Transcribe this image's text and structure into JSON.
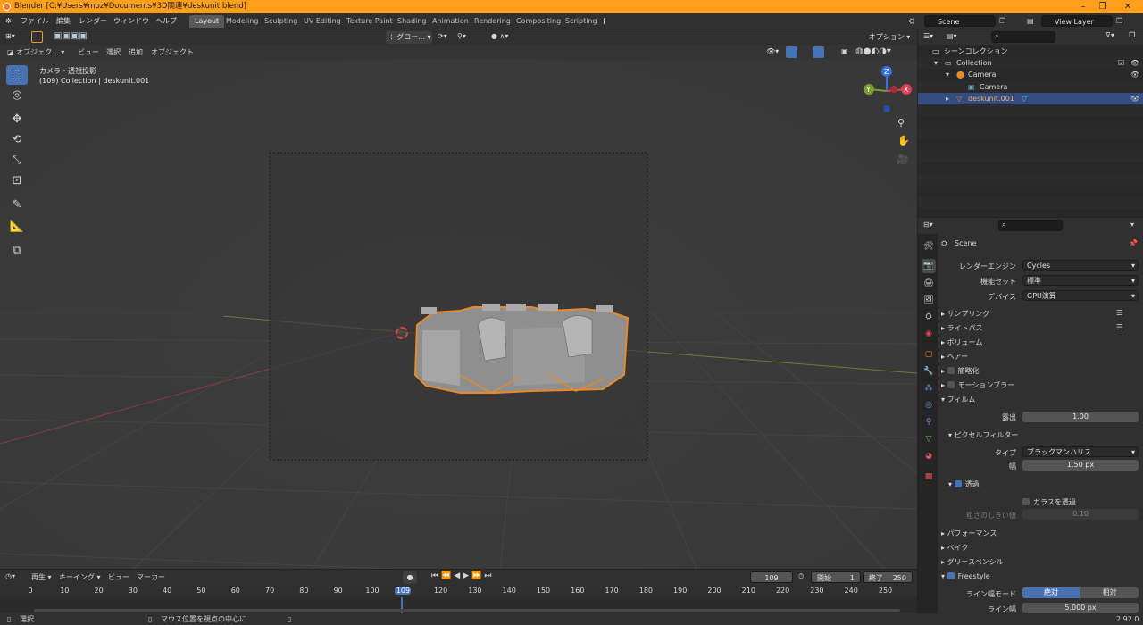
{
  "window": {
    "title": "Blender [C:¥Users¥moz¥Documents¥3D関連¥deskunit.blend]"
  },
  "menu": [
    "ファイル",
    "編集",
    "レンダー",
    "ウィンドウ",
    "ヘルプ"
  ],
  "workspaces": [
    "Layout",
    "Modeling",
    "Sculpting",
    "UV Editing",
    "Texture Paint",
    "Shading",
    "Animation",
    "Rendering",
    "Compositing",
    "Scripting"
  ],
  "top_right": {
    "scene": "Scene",
    "view_layer": "View Layer"
  },
  "viewport_header": {
    "transform": "グロー...",
    "options": "オプション"
  },
  "viewport_menu": {
    "mode": "オブジェク...",
    "view": "ビュー",
    "select": "選択",
    "add": "追加",
    "object": "オブジェクト"
  },
  "overlay_text": {
    "projection": "カメラ・透視投影",
    "collection": "(109) Collection | deskunit.001"
  },
  "gizmo": {
    "x": "X",
    "y": "Y",
    "z": "Z"
  },
  "outliner": {
    "root": "シーンコレクション",
    "collection": "Collection",
    "camera_obj": "Camera",
    "camera_data": "Camera",
    "object": "deskunit.001"
  },
  "properties": {
    "scene_name": "Scene",
    "render_engine_label": "レンダーエンジン",
    "render_engine": "Cycles",
    "feature_set_label": "機能セット",
    "feature_set": "標準",
    "device_label": "デバイス",
    "device": "GPU演算",
    "sections": {
      "sampling": "サンプリング",
      "light_paths": "ライトパス",
      "volumes": "ボリューム",
      "hair": "ヘアー",
      "simplify": "簡略化",
      "motion_blur": "モーションブラー",
      "film": "フィルム"
    },
    "exposure_label": "露出",
    "exposure": "1.00",
    "pixel_filter": "ピクセルフィルター",
    "type_label": "タイプ",
    "type": "ブラックマンハリス",
    "width_label": "幅",
    "width": "1.50 px",
    "transparent": "透過",
    "transparent_glass": "ガラスを透過",
    "roughness_label": "粗さのしきい値",
    "roughness": "0.10",
    "performance": "パフォーマンス",
    "bake": "ベイク",
    "grease_pencil": "グリースペンシル",
    "freestyle": "Freestyle",
    "line_width_mode_label": "ライン幅モード",
    "absolute": "絶対",
    "relative": "相対",
    "line_width_label": "ライン幅",
    "line_width": "5.000 px"
  },
  "timeline": {
    "playback": "再生",
    "keying": "キーイング",
    "view": "ビュー",
    "marker": "マーカー",
    "current": "109",
    "start_label": "開始",
    "start": "1",
    "end_label": "終了",
    "end": "250",
    "ticks": [
      "0",
      "10",
      "20",
      "30",
      "40",
      "50",
      "60",
      "70",
      "80",
      "90",
      "100",
      "109",
      "120",
      "130",
      "140",
      "150",
      "160",
      "170",
      "180",
      "190",
      "200",
      "210",
      "220",
      "230",
      "240",
      "250"
    ]
  },
  "status": {
    "select": "選択",
    "hint": "マウス位置を視点の中心に",
    "version": "2.92.0"
  }
}
